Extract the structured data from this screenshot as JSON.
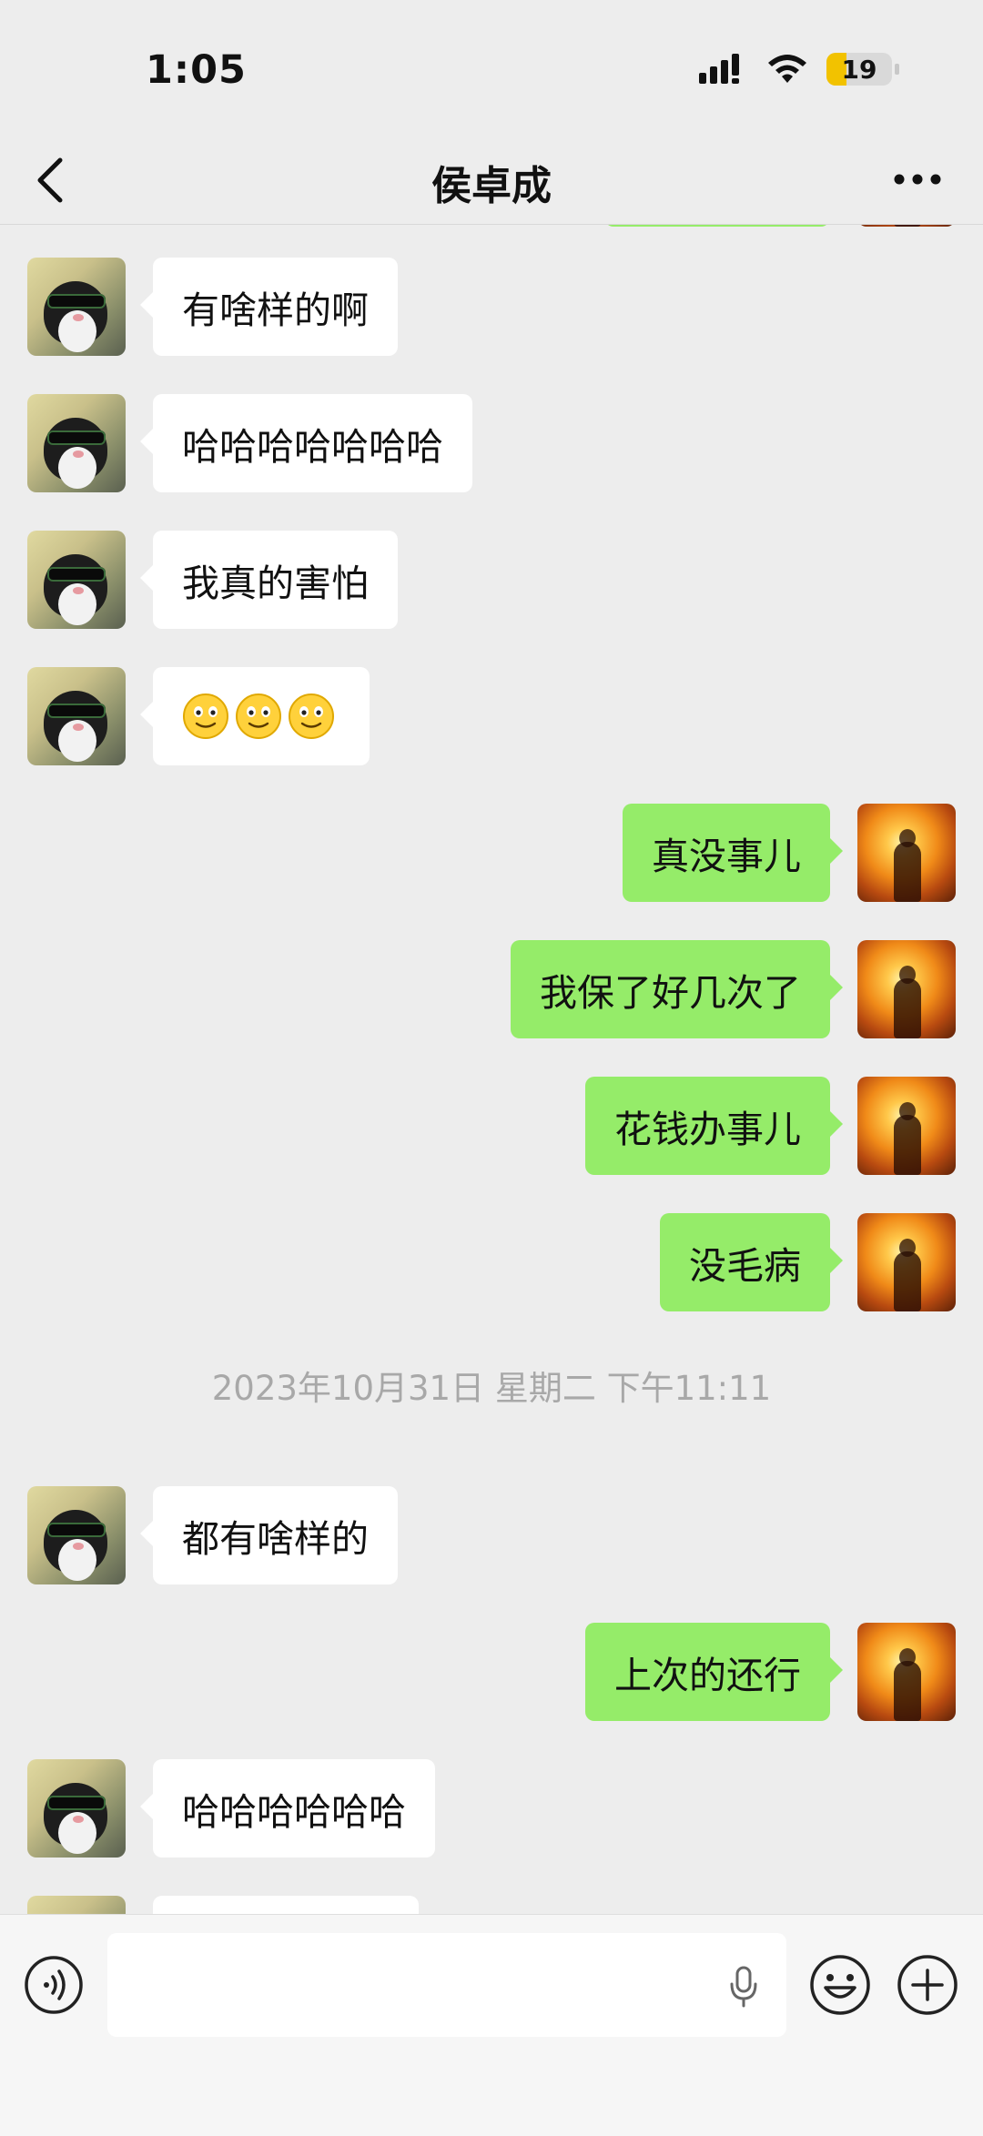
{
  "status_bar": {
    "time": "1:05",
    "battery": "19",
    "battery_level": 0.19,
    "battery_color": "#f2c200",
    "icons": [
      "signal-icon",
      "wifi-icon",
      "battery-icon"
    ]
  },
  "header": {
    "title": "侯卓成",
    "back_icon": "chevron-left-icon",
    "more_icon": "more-dots-icon"
  },
  "colors": {
    "background": "#ededed",
    "incoming_bubble": "#ffffff",
    "outgoing_bubble": "#95ec69",
    "timestamp_text": "#a8a8a8"
  },
  "messages": [
    {
      "side": "left",
      "text": "有啥样的啊"
    },
    {
      "side": "left",
      "text": "哈哈哈哈哈哈哈"
    },
    {
      "side": "left",
      "text": "我真的害怕"
    },
    {
      "side": "left",
      "text": "",
      "emojis": [
        "smile-emoji",
        "smile-emoji",
        "smile-emoji"
      ]
    },
    {
      "side": "right",
      "text": "真没事儿"
    },
    {
      "side": "right",
      "text": "我保了好几次了"
    },
    {
      "side": "right",
      "text": "花钱办事儿"
    },
    {
      "side": "right",
      "text": "没毛病"
    },
    {
      "type": "timestamp",
      "text": "2023年10月31日 星期二 下午11:11"
    },
    {
      "side": "left",
      "text": "都有啥样的"
    },
    {
      "side": "right",
      "text": "上次的还行"
    },
    {
      "side": "left",
      "text": "哈哈哈哈哈哈"
    }
  ],
  "input_bar": {
    "voice_icon": "voice-toggle-icon",
    "input_value": "",
    "mic_icon": "microphone-icon",
    "emoji_icon": "emoji-icon",
    "plus_icon": "plus-icon"
  }
}
